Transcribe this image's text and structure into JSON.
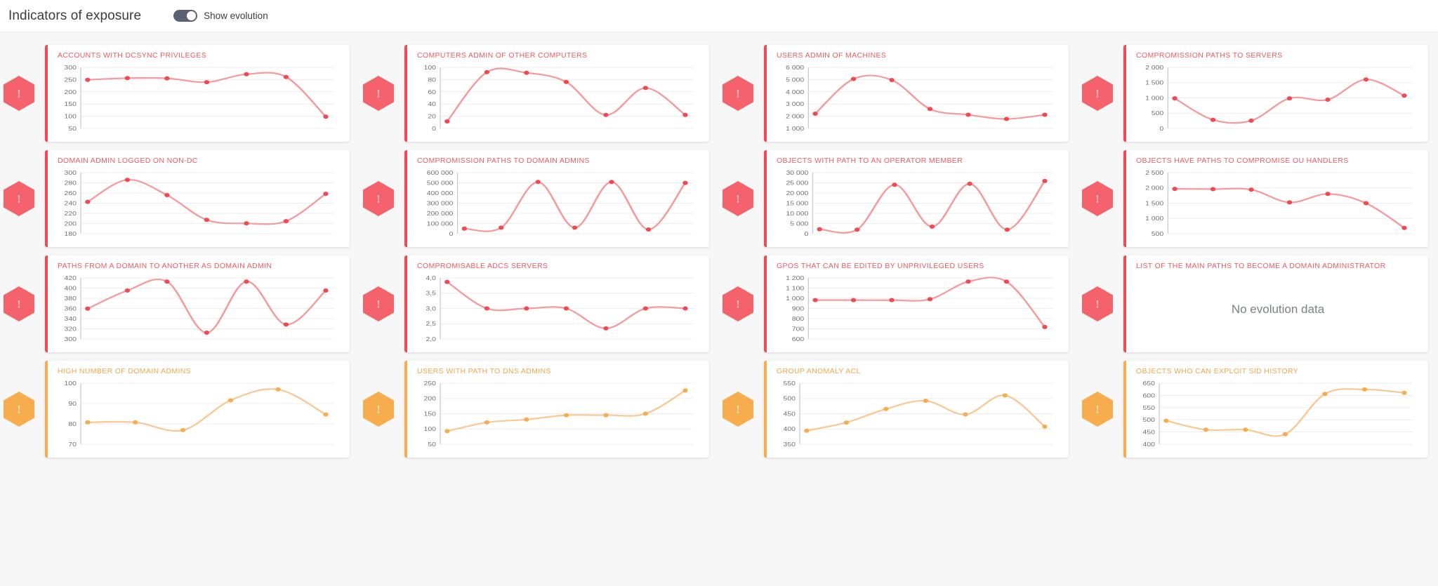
{
  "header": {
    "title": "Indicators of exposure",
    "toggle_label": "Show evolution",
    "toggle_on": true
  },
  "colors": {
    "critical": "#ef4b54",
    "critical_line": "#f59a9e",
    "critical_dot": "#f4474f",
    "warning": "#f7ad4e",
    "warning_line": "#f9c894",
    "warning_dot": "#f7ad4e",
    "grid": "#ededed",
    "tick_text": "#6d7178"
  },
  "badges": {
    "critical_glyph": "!",
    "warning_glyph": "!"
  },
  "no_evolution_text": "No evolution data",
  "chart_data": [
    {
      "type": "line",
      "title": "ACCOUNTS WITH DCSYNC PRIVILEGES",
      "severity": "critical",
      "ticks": [
        300,
        250,
        200,
        150,
        100,
        50
      ],
      "ylim": [
        30,
        315
      ],
      "values": [
        257,
        265,
        264,
        246,
        283,
        270,
        85
      ]
    },
    {
      "type": "line",
      "title": "COMPUTERS ADMIN OF OTHER COMPUTERS",
      "severity": "critical",
      "ticks": [
        100,
        80,
        60,
        40,
        20,
        0
      ],
      "ylim": [
        -5,
        108
      ],
      "values": [
        8,
        99,
        98,
        81,
        20,
        70,
        20
      ]
    },
    {
      "type": "line",
      "title": "USERS ADMIN OF MACHINES",
      "severity": "critical",
      "ticks": [
        "6 000",
        "5 000",
        "4 000",
        "3 000",
        "2 000",
        "1 000"
      ],
      "ylim": [
        600,
        6400
      ],
      "values": [
        2000,
        5300,
        5200,
        2450,
        1900,
        1500,
        1900
      ]
    },
    {
      "type": "line",
      "title": "COMPROMISSION PATHS TO SERVERS",
      "severity": "critical",
      "ticks": [
        "2 000",
        "1 500",
        "1 000",
        "500",
        "0"
      ],
      "ylim": [
        -120,
        2150
      ],
      "values": [
        1000,
        200,
        170,
        1000,
        950,
        1700,
        1100
      ]
    },
    {
      "type": "line",
      "title": "DOMAIN ADMIN LOGGED ON NON-DC",
      "severity": "critical",
      "ticks": [
        300,
        280,
        260,
        240,
        220,
        200,
        180
      ],
      "ylim": [
        172,
        308
      ],
      "values": [
        243,
        292,
        258,
        203,
        195,
        200,
        261
      ]
    },
    {
      "type": "line",
      "title": "COMPROMISSION PATHS TO DOMAIN ADMINS",
      "severity": "critical",
      "ticks": [
        "600 000",
        "500 000",
        "400 000",
        "300 000",
        "200 000",
        "100 000",
        "0"
      ],
      "ylim": [
        -35000,
        620000
      ],
      "values": [
        20000,
        30000,
        520000,
        30000,
        520000,
        10000,
        510000
      ]
    },
    {
      "type": "line",
      "title": "OBJECTS WITH PATH TO AN OPERATOR MEMBER",
      "severity": "critical",
      "ticks": [
        "30 000",
        "25 000",
        "20 000",
        "15 000",
        "10 000",
        "5 000",
        "0"
      ],
      "ylim": [
        -1800,
        31000
      ],
      "values": [
        600,
        400,
        24500,
        2000,
        25000,
        400,
        26500
      ]
    },
    {
      "type": "line",
      "title": "OBJECTS HAVE PATHS TO COMPROMISE OU HANDLERS",
      "severity": "critical",
      "ticks": [
        "2 500",
        "2 000",
        "1 500",
        "1 000",
        "500"
      ],
      "ylim": [
        300,
        2600
      ],
      "values": [
        1990,
        1980,
        1960,
        1480,
        1800,
        1450,
        520
      ]
    },
    {
      "type": "line",
      "title": "PATHS FROM A DOMAIN TO ANOTHER AS DOMAIN ADMIN",
      "severity": "critical",
      "ticks": [
        420,
        400,
        380,
        360,
        340,
        320,
        300
      ],
      "ylim": [
        293,
        428
      ],
      "values": [
        360,
        400,
        420,
        307,
        420,
        325,
        400
      ]
    },
    {
      "type": "line",
      "title": "COMPROMISABLE ADCS SERVERS",
      "severity": "critical",
      "ticks": [
        "4,0",
        "3,5",
        "3,0",
        "2,5",
        "2,0"
      ],
      "ylim": [
        1.85,
        4.15
      ],
      "values": [
        4.0,
        3.0,
        3.0,
        3.0,
        2.25,
        3.0,
        3.0
      ]
    },
    {
      "type": "line",
      "title": "GPOS THAT CAN BE EDITED BY UNPRIVILEGED USERS",
      "severity": "critical",
      "ticks": [
        "1 200",
        "1 100",
        "1 000",
        "900",
        "800",
        "700",
        "600"
      ],
      "ylim": [
        580,
        1240
      ],
      "values": [
        1000,
        1000,
        1000,
        1010,
        1200,
        1200,
        710
      ]
    },
    {
      "type": "none",
      "title": "LIST OF THE MAIN PATHS TO BECOME A DOMAIN ADMINISTRATOR",
      "severity": "critical"
    },
    {
      "type": "line",
      "title": "HIGH NUMBER OF DOMAIN ADMINS",
      "severity": "warning",
      "ticks": [
        100,
        90,
        80,
        70
      ],
      "ylim": [
        66,
        105
      ],
      "values": [
        80,
        80,
        75,
        94,
        101,
        85
      ]
    },
    {
      "type": "line",
      "title": "USERS WITH PATH TO DNS ADMINS",
      "severity": "warning",
      "ticks": [
        250,
        200,
        150,
        100,
        50
      ],
      "ylim": [
        55,
        265
      ],
      "values": [
        100,
        130,
        140,
        155,
        155,
        160,
        240
      ]
    },
    {
      "type": "line",
      "title": "GROUP ANOMALY ACL",
      "severity": "warning",
      "ticks": [
        550,
        500,
        450,
        400,
        350
      ],
      "ylim": [
        340,
        565
      ],
      "values": [
        390,
        420,
        470,
        500,
        450,
        520,
        405
      ]
    },
    {
      "type": "line",
      "title": "OBJECTS WHO CAN EXPLOIT SID HISTORY",
      "severity": "warning",
      "ticks": [
        650,
        600,
        550,
        500,
        450,
        400
      ],
      "ylim": [
        395,
        668
      ],
      "values": [
        500,
        460,
        460,
        440,
        620,
        640,
        625
      ]
    }
  ]
}
